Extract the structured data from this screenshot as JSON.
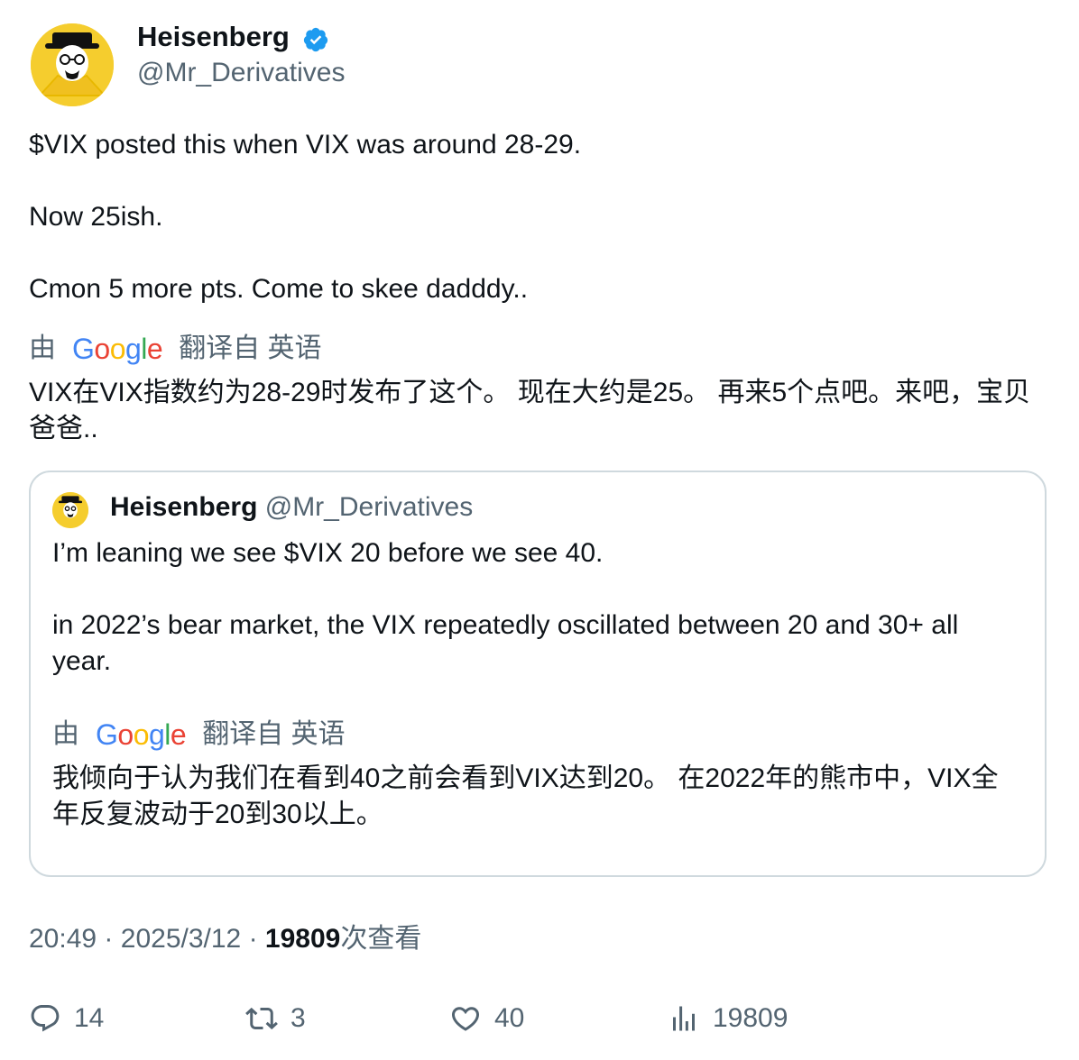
{
  "author": {
    "display_name": "Heisenberg",
    "handle": "@Mr_Derivatives",
    "verified_icon": "verified-badge-icon",
    "accent_color": "#1d9bf0"
  },
  "tweet": {
    "lines": [
      "$VIX posted this when VIX was around 28-29.",
      "Now 25ish.",
      "Cmon 5 more pts. Come to skee dadddy.."
    ],
    "translation": {
      "prefix": "由",
      "provider_logo": "Google",
      "suffix": "翻译自 英语",
      "text": "VIX在VIX指数约为28-29时发布了这个。 现在大约是25。 再来5个点吧。来吧，宝贝爸爸.."
    }
  },
  "quoted_tweet": {
    "display_name": "Heisenberg",
    "handle": "@Mr_Derivatives",
    "lines": [
      "I’m leaning we see $VIX 20 before we see 40.",
      "in 2022’s bear market, the VIX repeatedly oscillated between 20 and 30+ all",
      "year."
    ],
    "translation": {
      "prefix": "由",
      "provider_logo": "Google",
      "suffix": "翻译自 英语",
      "text": "我倾向于认为我们在看到40之前会看到VIX达到20。 在2022年的熊市中，VIX全年反复波动于20到30以上。"
    }
  },
  "meta": {
    "time": "20:49",
    "separator": "·",
    "date": "2025/3/12",
    "views": "19809",
    "views_label": "次查看"
  },
  "actions": {
    "replies": "14",
    "retweets": "3",
    "likes": "40",
    "views": "19809"
  }
}
